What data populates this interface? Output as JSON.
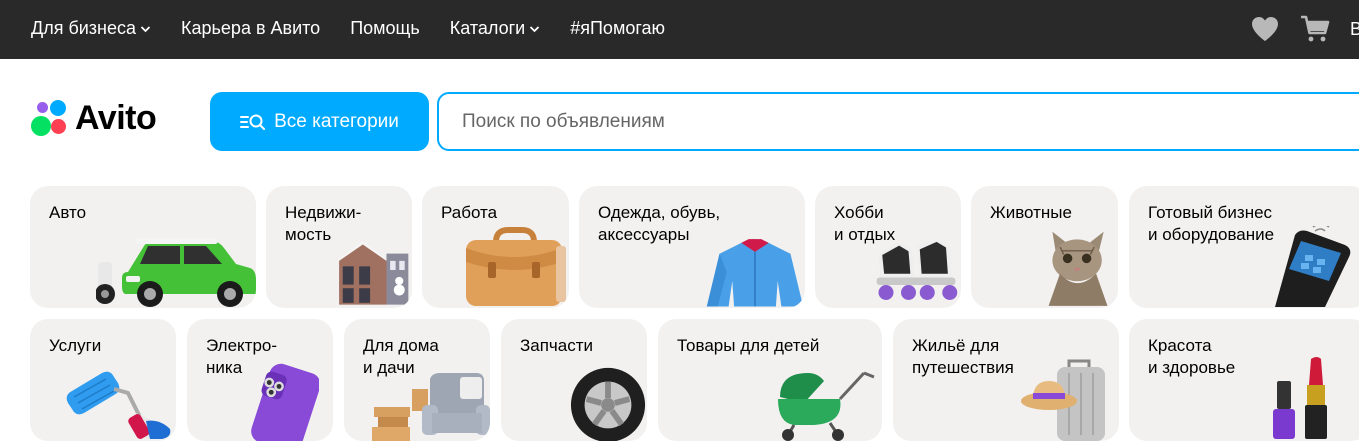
{
  "topbar": {
    "items": [
      {
        "label": "Для бизнеса",
        "dropdown": true
      },
      {
        "label": "Карьера в Авито",
        "dropdown": false
      },
      {
        "label": "Помощь",
        "dropdown": false
      },
      {
        "label": "Каталоги",
        "dropdown": true
      },
      {
        "label": "#яПомогаю",
        "dropdown": false
      }
    ],
    "icons": [
      "heart-icon",
      "cart-icon"
    ],
    "cut_label": "В"
  },
  "header": {
    "logo_text": "Avito",
    "categories_button": "Все категории",
    "search_placeholder": "Поиск по объявлениям"
  },
  "colors": {
    "accent": "#00aaff",
    "topbar": "#292929",
    "card_bg": "#f2f1f0",
    "logo_dots": [
      "#04e061",
      "#ff4053",
      "#965eeb",
      "#0af"
    ]
  },
  "categories": {
    "row1": [
      {
        "label": "Авто",
        "icon": "car-icon"
      },
      {
        "label": "Недвижи-\nмость",
        "icon": "house-icon"
      },
      {
        "label": "Работа",
        "icon": "briefcase-icon"
      },
      {
        "label": "Одежда, обувь,\nаксессуары",
        "icon": "jacket-icon"
      },
      {
        "label": "Хобби\nи отдых",
        "icon": "roller-skate-icon"
      },
      {
        "label": "Животные",
        "icon": "cat-icon"
      },
      {
        "label": "Готовый бизнес\nи оборудование",
        "icon": "payment-terminal-icon"
      }
    ],
    "row2": [
      {
        "label": "Услуги",
        "icon": "paint-roller-icon"
      },
      {
        "label": "Электро-\nника",
        "icon": "phone-icon"
      },
      {
        "label": "Для дома\nи дачи",
        "icon": "armchair-icon"
      },
      {
        "label": "Запчасти",
        "icon": "tire-icon"
      },
      {
        "label": "Товары для детей",
        "icon": "stroller-icon"
      },
      {
        "label": "Жильё для\nпутешествия",
        "icon": "suitcase-icon"
      },
      {
        "label": "Красота\nи здоровье",
        "icon": "lipstick-icon"
      }
    ]
  }
}
